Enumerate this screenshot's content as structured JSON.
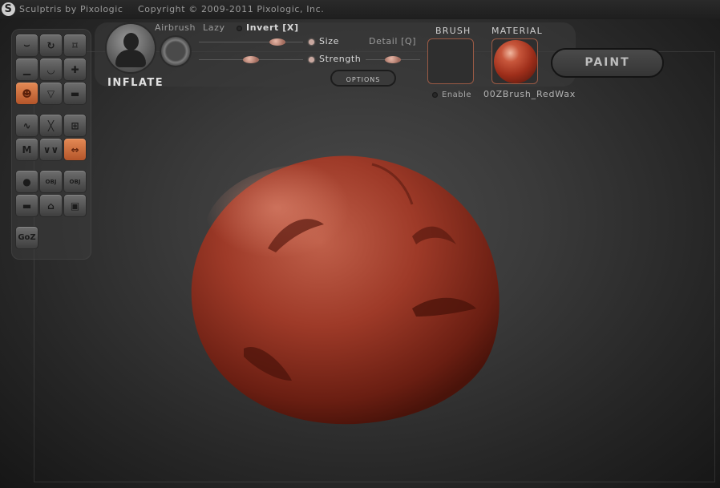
{
  "titlebar": {
    "app_name": "Sculptris by Pixologic",
    "copyright": "Copyright © 2009-2011 Pixologic, Inc."
  },
  "brush": {
    "current_tool": "INFLATE",
    "airbrush_label": "Airbrush",
    "lazy_label": "Lazy",
    "invert_label": "Invert [X]",
    "size_label": "Size",
    "detail_label": "Detail [Q]",
    "strength_label": "Strength",
    "options_label": "OPTIONS",
    "size_value": 0.75,
    "strength_value": 0.5,
    "detail_value": 0.5
  },
  "brush_panel": {
    "title": "BRUSH",
    "enable_label": "Enable"
  },
  "material_panel": {
    "title": "MATERIAL",
    "name": "00ZBrush_RedWax"
  },
  "paint_button": "PAINT",
  "goz_label": "GoZ",
  "tool_obj_label": "OBJ",
  "colors": {
    "accent_orange": "#d4703f",
    "model_red": "#9e3a28",
    "background": "#3a3a3a"
  }
}
